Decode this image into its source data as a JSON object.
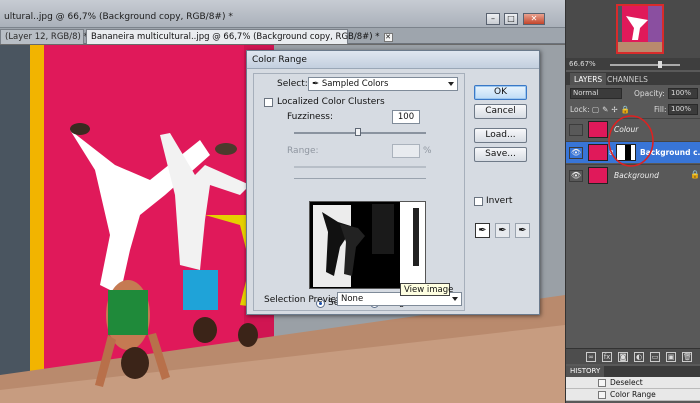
{
  "window": {
    "title": "ultural..jpg @ 66,7% (Background copy, RGB/8#) *",
    "min_label": "–",
    "max_label": "□",
    "close_label": "✕"
  },
  "tabs": [
    {
      "label": "(Layer 12, RGB/8) *",
      "close": "✕"
    },
    {
      "label": "Bananeira multicultural..jpg @ 66,7% (Background copy, RGB/8#) *",
      "close": "✕"
    }
  ],
  "dialog": {
    "title": "Color Range",
    "select_label": "Select:",
    "select_value": "Sampled Colors",
    "localized_label": "Localized Color Clusters",
    "fuzziness_label": "Fuzziness:",
    "fuzziness_value": "100",
    "range_label": "Range:",
    "range_unit": "%",
    "selection_option": "Selection",
    "image_option": "Image",
    "preview_label": "Selection Preview:",
    "preview_value": "None",
    "invert_label": "Invert",
    "buttons": {
      "ok": "OK",
      "cancel": "Cancel",
      "load": "Load...",
      "save": "Save..."
    },
    "tools": [
      "eyedropper-icon",
      "eyedropper-plus-icon",
      "eyedropper-minus-icon"
    ]
  },
  "tooltip": "View image",
  "navigator": {
    "zoom": "66.67%"
  },
  "layers_panel": {
    "tabs": [
      "LAYERS",
      "CHANNELS"
    ],
    "blend_mode": "Normal",
    "opacity_label": "Opacity:",
    "opacity_value": "100%",
    "lock_label": "Lock:",
    "fill_label": "Fill:",
    "fill_value": "100%",
    "layers": [
      {
        "name": "Colour",
        "visible": false,
        "selected": false
      },
      {
        "name": "Background c...",
        "visible": true,
        "selected": true
      },
      {
        "name": "Background",
        "visible": true,
        "selected": false
      }
    ],
    "bottom_icons": [
      "link-icon",
      "fx-icon",
      "mask-icon",
      "adjustment-icon",
      "folder-icon",
      "new-layer-icon",
      "trash-icon"
    ]
  },
  "history_panel": {
    "tab": "HISTORY",
    "items": [
      "Deselect",
      "Color Range"
    ]
  },
  "colors": {
    "selection_blue": "#3875d7",
    "wall_pink": "#e0195a",
    "annotation_red": "#e02020"
  }
}
